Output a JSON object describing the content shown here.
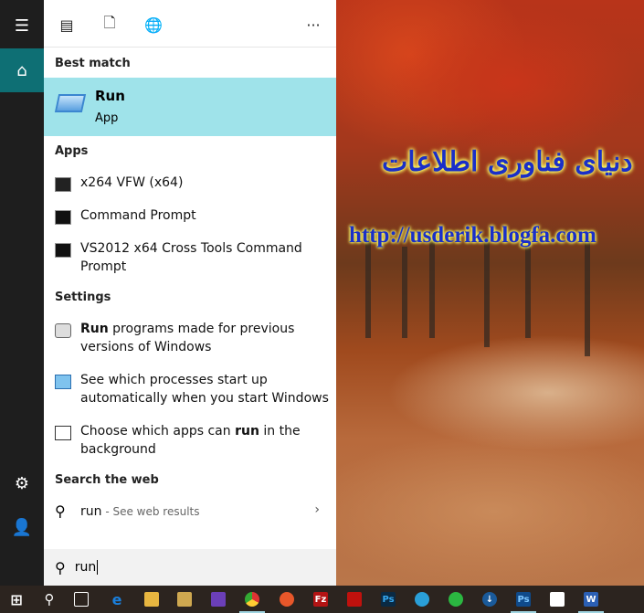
{
  "wallpaper": {
    "title_fa": "دنیای فناوری اطلاعات",
    "url": "http://usderik.blogfa.com"
  },
  "rail": {
    "icons": [
      "hamburger-menu-icon",
      "home-icon",
      "settings-icon",
      "user-icon"
    ],
    "accent": "#0e6f74"
  },
  "toolbar": {
    "icons": [
      "apps-icon",
      "document-icon",
      "web-icon"
    ],
    "more": "···"
  },
  "best_match": {
    "header": "Best match",
    "title": "Run",
    "subtitle": "App",
    "highlight": "#9fe3ea"
  },
  "apps": {
    "header": "Apps",
    "items": [
      {
        "label": "x264 VFW (x64)"
      },
      {
        "label": "Command Prompt"
      },
      {
        "label_line1": "VS2012 x64 Cross Tools Command",
        "label_line2": "Prompt"
      }
    ]
  },
  "settings": {
    "header": "Settings",
    "items": [
      {
        "bold": "Run",
        "rest": " programs made for previous",
        "line2": "versions of Windows"
      },
      {
        "line1": "See which processes start up",
        "line2": "automatically when you start Windows"
      },
      {
        "pre": "Choose which apps can ",
        "bold": "run",
        "post": " in the",
        "line2": "background"
      }
    ]
  },
  "web": {
    "header": "Search the web",
    "query": "run",
    "suffix": " - See web results"
  },
  "search": {
    "value": "run"
  },
  "taskbar": {
    "icons": [
      "start",
      "search",
      "task-view",
      "edge",
      "file-explorer",
      "snipping-tool",
      "visual-studio",
      "chrome",
      "firefox",
      "filezilla",
      "acrobat",
      "photoshop",
      "telegram",
      "whatsapp",
      "download-manager",
      "photoshop-2",
      "mail",
      "word"
    ]
  }
}
